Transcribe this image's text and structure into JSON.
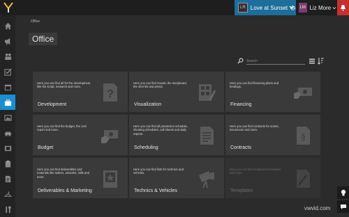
{
  "topbar": {
    "logo_icon": "y-logo-icon",
    "project": {
      "thumb": "LR",
      "name": "Love at Sunset",
      "gear_icon": "gear-icon",
      "chevron_icon": "chevron-down-icon"
    },
    "user": {
      "initials": "LM",
      "name": "Liz More",
      "chevron_icon": "chevron-down-icon"
    },
    "notifications_icon": "bell-icon",
    "accent": "#1d6e9a",
    "alert_color": "#c62f2f"
  },
  "sidebar": {
    "items": [
      {
        "icon": "home-icon"
      },
      {
        "icon": "megaphone-icon"
      },
      {
        "icon": "people-icon"
      },
      {
        "icon": "checklist-icon"
      },
      {
        "icon": "calendar-icon"
      },
      {
        "icon": "briefcase-icon",
        "active": true
      },
      {
        "icon": "image-icon"
      },
      {
        "icon": "car-icon"
      },
      {
        "icon": "film-icon"
      },
      {
        "icon": "clipboard-icon"
      },
      {
        "icon": "document-icon"
      },
      {
        "icon": "hanger-icon"
      },
      {
        "icon": "tools-icon"
      }
    ],
    "active_color": "#1a8fcf"
  },
  "breadcrumb": "Office",
  "page_title": "Office",
  "search": {
    "placeholder": "Search",
    "icon": "search-icon"
  },
  "view_controls": {
    "list_icon": "list-view-icon",
    "sort_icon": "sort-icon"
  },
  "cards": [
    {
      "name": "Development",
      "description": "Here you can find all for the development like the script, research and more.",
      "icon": "question-document-icon"
    },
    {
      "name": "Visualization",
      "description": "Here you can find moods, the storyboard, the shot list and presiz.",
      "icon": "storyboard-icon"
    },
    {
      "name": "Financing",
      "description": "Here you can find financing plans and fundings.",
      "icon": "money-hand-icon"
    },
    {
      "name": "Budget",
      "description": "Here you can find the budget, the cost report and more.",
      "icon": "money-hand-icon"
    },
    {
      "name": "Scheduling",
      "description": "Here you can find all production schedule, shooting schedules, call sheets and daily reports.",
      "icon": "schedule-document-icon"
    },
    {
      "name": "Contracts",
      "description": "Here you can find contracts for actors, insurances and more.",
      "icon": "contract-icon"
    },
    {
      "name": "Deliverables & Marketing",
      "description": "Here you can find deliverables and materials like trailers, artworks, stills and more.",
      "icon": "poster-icon"
    },
    {
      "name": "Technics & Vehicles",
      "description": "Here you can find lists for technics and vehicles.",
      "icon": "spotlight-icon"
    },
    {
      "name": "Templates",
      "description": "Here you can find templates for tenders and more.",
      "icon": "template-icon",
      "disabled": true
    }
  ],
  "help_icon": "lightbulb-icon",
  "chat_icon": "chat-icon",
  "watermark": "vwvid.com"
}
